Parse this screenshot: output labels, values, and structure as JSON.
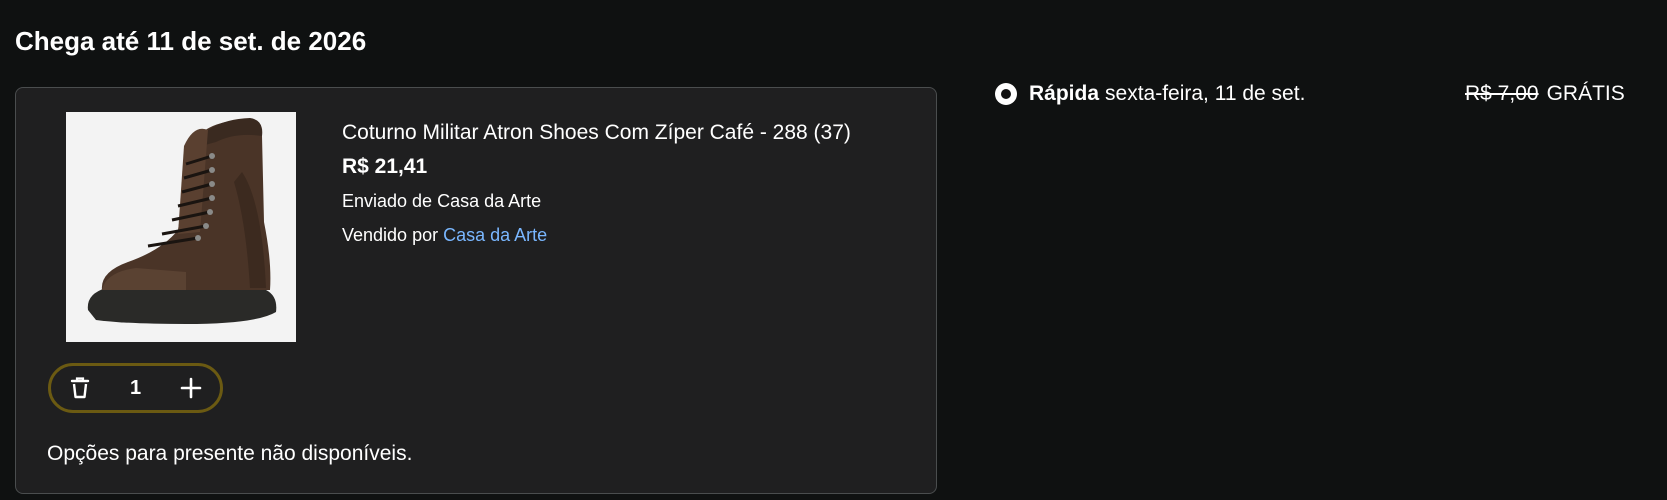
{
  "heading": "Chega até 11 de set. de 2026",
  "product": {
    "title": "Coturno Militar Atron Shoes Com Zíper Café - 288 (37)",
    "price": "R$ 21,41",
    "shipped_from": "Enviado de Casa da Arte",
    "sold_by_prefix": "Vendido por ",
    "seller": "Casa da Arte",
    "image_icon": "boot-image"
  },
  "quantity": {
    "value": "1",
    "delete_icon": "trash-icon",
    "add_icon": "plus-icon"
  },
  "gift_note": "Opções para presente não disponíveis.",
  "delivery_option": {
    "speed": "Rápida",
    "date": "sexta-feira, 11 de set.",
    "old_price": "R$ 7,00",
    "price": "GRÁTIS"
  },
  "colors": {
    "background": "#0f1111",
    "card": "#1f1f20",
    "link": "#7ab7ff",
    "qty_border": "#6b5a12"
  }
}
